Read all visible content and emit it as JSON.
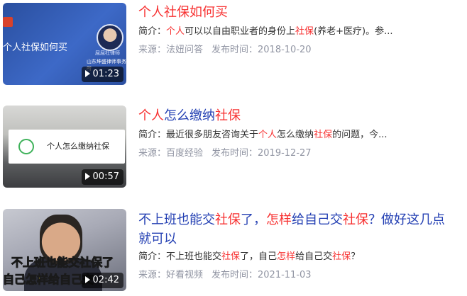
{
  "results": [
    {
      "title_parts": [
        {
          "text": "个人社保如何买",
          "hl": true
        }
      ],
      "desc_label": "简介：",
      "desc_parts": [
        {
          "text": "个人",
          "hl": true
        },
        {
          "text": "可以以自由职业者的身份上",
          "hl": false
        },
        {
          "text": "社保",
          "hl": true
        },
        {
          "text": "(养老+医疗)。参...",
          "hl": false
        }
      ],
      "source": "来源：法妞问答",
      "published": "发布时间：2018-10-20",
      "duration": "01:23",
      "thumb_caption": "个人社保如何买",
      "thumb_name1": "屈屈社律师",
      "thumb_name2": "山东坤盛律师事务所"
    },
    {
      "title_parts": [
        {
          "text": "个人",
          "hl": true
        },
        {
          "text": "怎么缴纳",
          "hl": false
        },
        {
          "text": "社保",
          "hl": true
        }
      ],
      "desc_label": "简介：",
      "desc_parts": [
        {
          "text": "最近很多朋友咨询关于",
          "hl": false
        },
        {
          "text": "个人",
          "hl": true
        },
        {
          "text": "怎么缴纳",
          "hl": false
        },
        {
          "text": "社保",
          "hl": true
        },
        {
          "text": "的问题，今...",
          "hl": false
        }
      ],
      "source": "来源：百度经验",
      "published": "发布时间：2019-12-27",
      "duration": "00:57",
      "thumb_caption": "个人怎么缴纳社保"
    },
    {
      "title_parts": [
        {
          "text": "不上班也能交",
          "hl": false
        },
        {
          "text": "社保",
          "hl": true
        },
        {
          "text": "了，",
          "hl": false
        },
        {
          "text": "怎样",
          "hl": true
        },
        {
          "text": "给自己交",
          "hl": false
        },
        {
          "text": "社保",
          "hl": true
        },
        {
          "text": "？做好这几点就可以",
          "hl": false
        }
      ],
      "desc_label": "简介：",
      "desc_parts": [
        {
          "text": "不上班也能交",
          "hl": false
        },
        {
          "text": "社保",
          "hl": true
        },
        {
          "text": "了，自己",
          "hl": false
        },
        {
          "text": "怎样",
          "hl": true
        },
        {
          "text": "给自己交",
          "hl": false
        },
        {
          "text": "社保",
          "hl": true
        },
        {
          "text": "？",
          "hl": false
        }
      ],
      "source": "来源：好看视频",
      "published": "发布时间：2021-11-03",
      "duration": "02:42",
      "thumb_caption1": "不上班也能交社保了",
      "thumb_caption2": "自己怎样给自己交"
    }
  ],
  "colors": {
    "title": "#2440b3",
    "highlight": "#f73131",
    "meta": "#9195a3"
  }
}
